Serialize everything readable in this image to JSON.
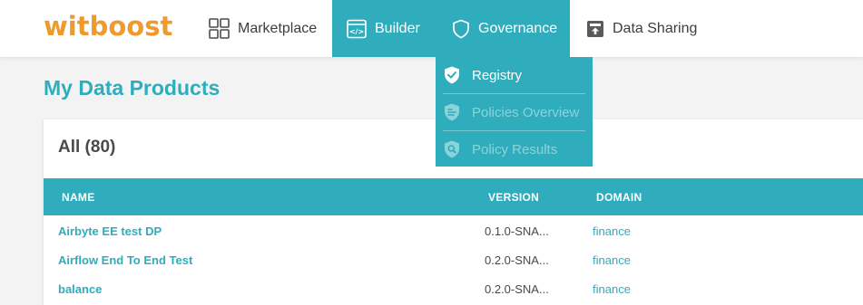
{
  "colors": {
    "accent": "#2fadbd",
    "logo": "#ee9a2c",
    "text": "#3d3d3d"
  },
  "header": {
    "logo_text": "witboost",
    "nav": [
      {
        "label": "Marketplace",
        "icon": "grid-icon",
        "active": false
      },
      {
        "label": "Builder",
        "icon": "code-window-icon",
        "active": true
      },
      {
        "label": "Governance",
        "icon": "shield-icon",
        "active": true
      },
      {
        "label": "Data Sharing",
        "icon": "share-box-icon",
        "active": false
      }
    ]
  },
  "governance_menu": {
    "items": [
      {
        "label": "Registry",
        "icon": "shield-check-icon",
        "active": true
      },
      {
        "label": "Policies Overview",
        "icon": "shield-list-icon",
        "active": false
      },
      {
        "label": "Policy Results",
        "icon": "shield-search-icon",
        "active": false
      }
    ]
  },
  "main": {
    "title": "My Data Products",
    "card": {
      "title": "All (80)",
      "columns": [
        "NAME",
        "VERSION",
        "DOMAIN"
      ],
      "rows": [
        {
          "name": "Airbyte EE test DP",
          "version": "0.1.0-SNA...",
          "domain": "finance"
        },
        {
          "name": "Airflow End To End Test",
          "version": "0.2.0-SNA...",
          "domain": "finance"
        },
        {
          "name": "balance",
          "version": "0.2.0-SNA...",
          "domain": "finance"
        }
      ]
    }
  }
}
